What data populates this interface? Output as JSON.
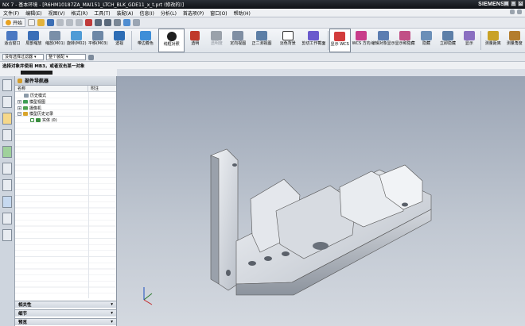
{
  "window": {
    "title": "NX 7 - 基本环境 - [R6HM10187ZA_MAI151_LTCH_BLK_GDE11_x_t.prt (修改的)]",
    "brand": "SIEMENS",
    "controls": [
      "_",
      "□",
      "×"
    ]
  },
  "menu": {
    "items": [
      "文件(F)",
      "编辑(E)",
      "视图(V)",
      "格式(R)",
      "工具(T)",
      "装配(A)",
      "信息(I)",
      "分析(L)",
      "首选项(P)",
      "窗口(O)",
      "帮助(H)"
    ]
  },
  "toolbar1": {
    "start_label": "开始"
  },
  "ribbon": {
    "buttons": [
      {
        "label": "适合窗口",
        "color": "#4a78c2"
      },
      {
        "label": "局部缩放",
        "color": "#3b6fb8"
      },
      {
        "label": "缩放(M01)",
        "color": "#7a8fa8"
      },
      {
        "label": "旋转(M02)",
        "color": "#4e9bd6"
      },
      {
        "label": "平移(M03)",
        "color": "#6d87a6"
      },
      {
        "label": "透视",
        "color": "#2d6db5"
      },
      {
        "label": "带边着色",
        "color": "#3e8ed8"
      },
      {
        "label": "线框对照",
        "color": "#1f1f1f"
      },
      {
        "label": "透明",
        "color": "#c0392b"
      },
      {
        "label": "透明度",
        "color": "#9aa1aa"
      },
      {
        "label": "定向视图",
        "color": "#7f8ea3"
      },
      {
        "label": "正二测视图",
        "color": "#5c7ea6"
      },
      {
        "label": "淡色背景",
        "color": "#ffffff"
      },
      {
        "label": "剪切工作截面",
        "color": "#6a5acd"
      },
      {
        "label": "显示 WCS",
        "color": "#d23b3b"
      },
      {
        "label": "WCS 方向",
        "color": "#c83c8a"
      },
      {
        "label": "编辑对象显示",
        "color": "#5b7db1"
      },
      {
        "label": "显示和隐藏",
        "color": "#c14f86"
      },
      {
        "label": "隐藏",
        "color": "#6b8fb8"
      },
      {
        "label": "立即隐藏",
        "color": "#5d7fa8"
      },
      {
        "label": "显示",
        "color": "#8a6fc1"
      },
      {
        "label": "测量距离",
        "color": "#c9a227"
      },
      {
        "label": "测量角度",
        "color": "#b37d2e"
      }
    ]
  },
  "filterbar": {
    "type_filter": "没有选择过滤器",
    "scope": "整个装配"
  },
  "cue": {
    "text": "选择对象并使用 MB3，或者双击某一对象"
  },
  "navigator": {
    "title": "部件导航器",
    "columns": {
      "name": "名称",
      "attachment": "附注"
    },
    "rows": [
      {
        "label": "历史模式",
        "expander": "",
        "indent": 0,
        "icon_color": "#8c9aa8"
      },
      {
        "label": "模型视图",
        "expander": "+",
        "indent": 0,
        "icon_color": "#3f9e55"
      },
      {
        "label": "摄像机",
        "expander": "+",
        "indent": 0,
        "icon_color": "#4ca24e"
      },
      {
        "label": "模型历史记录",
        "expander": "−",
        "indent": 0,
        "icon_color": "#d9a52b"
      },
      {
        "label": "实体 (0)",
        "expander": "",
        "indent": 1,
        "icon_color": "#3a8e3f"
      }
    ],
    "panels": [
      "相关性",
      "细节",
      "预览"
    ]
  }
}
